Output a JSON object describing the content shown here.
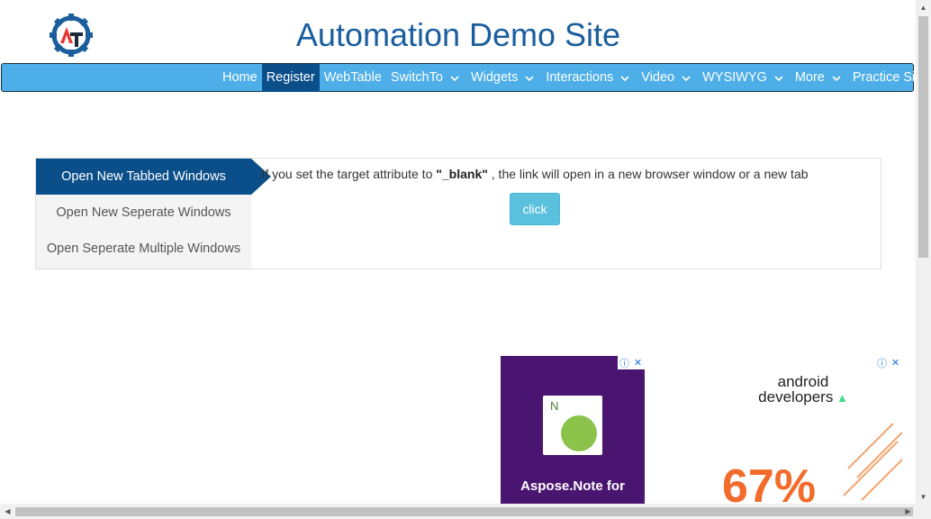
{
  "header": {
    "title": "Automation Demo Site"
  },
  "nav": {
    "items": [
      {
        "label": "Home",
        "dropdown": false,
        "active": false
      },
      {
        "label": "Register",
        "dropdown": false,
        "active": true
      },
      {
        "label": "WebTable",
        "dropdown": false,
        "active": false
      },
      {
        "label": "SwitchTo",
        "dropdown": true,
        "active": false
      },
      {
        "label": "Widgets",
        "dropdown": true,
        "active": false
      },
      {
        "label": "Interactions",
        "dropdown": true,
        "active": false
      },
      {
        "label": "Video",
        "dropdown": true,
        "active": false
      },
      {
        "label": "WYSIWYG",
        "dropdown": true,
        "active": false
      },
      {
        "label": "More",
        "dropdown": true,
        "active": false
      },
      {
        "label": "Practice Site",
        "dropdown": false,
        "active": false
      }
    ]
  },
  "windows": {
    "tabs": [
      {
        "label": "Open New Tabbed Windows",
        "active": true
      },
      {
        "label": "Open New Seperate Windows",
        "active": false
      },
      {
        "label": "Open Seperate Multiple Windows",
        "active": false
      }
    ],
    "description_before": "If you set the target attribute to ",
    "description_bold": "\"_blank\"",
    "description_after": " , the link will open in a new browser window or a new tab",
    "button_label": "click"
  },
  "ads": {
    "ad1": {
      "headline": "Aspose.Note for",
      "icon_letter": "N"
    },
    "ad2": {
      "brand_line1": "android",
      "brand_line2": "developers",
      "percent": "67%"
    }
  },
  "colors": {
    "brand": "#1a5e9e",
    "navbar": "#4daee8",
    "active": "#0b4f8a",
    "button": "#5bc0de"
  }
}
